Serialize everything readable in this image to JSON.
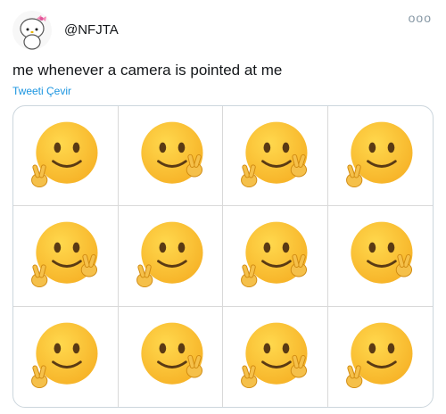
{
  "tweet": {
    "handle": "@NFJTA",
    "text": "me whenever a camera is pointed at me",
    "translate_label": "Tweeti Çevir",
    "more_label": "ooo"
  },
  "colors": {
    "link": "#1b95e0",
    "face": "#f7b52a",
    "hand": "#f5c04a"
  },
  "media": {
    "rows": 3,
    "cols": 4,
    "cells": [
      {
        "hand": "left"
      },
      {
        "hand": "right"
      },
      {
        "hand": "both"
      },
      {
        "hand": "left"
      },
      {
        "hand": "both"
      },
      {
        "hand": "left"
      },
      {
        "hand": "both"
      },
      {
        "hand": "right"
      },
      {
        "hand": "left"
      },
      {
        "hand": "right"
      },
      {
        "hand": "both"
      },
      {
        "hand": "left"
      }
    ]
  }
}
